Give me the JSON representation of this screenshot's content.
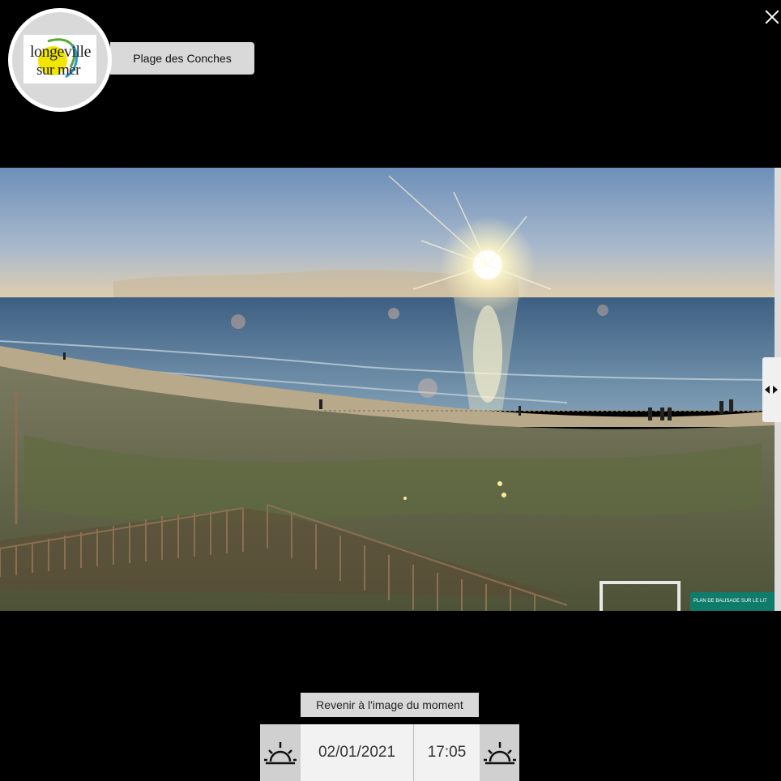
{
  "logo": {
    "line1": "longeville",
    "line2": "sur mer"
  },
  "location": {
    "name": "Plage des Conches"
  },
  "controls": {
    "return_label": "Revenir à l'image du moment",
    "date": "02/01/2021",
    "time": "17:05"
  },
  "panorama_sign_text": "PLAN DE BALISAGE SUR LE LIT",
  "icons": {
    "close": "close-icon",
    "pan": "pan-arrows-icon",
    "sunrise": "sunrise-icon",
    "sunset": "sunset-icon"
  },
  "colors": {
    "background": "#000000",
    "panel": "#d9d9d9",
    "field": "#f2f2f2"
  }
}
